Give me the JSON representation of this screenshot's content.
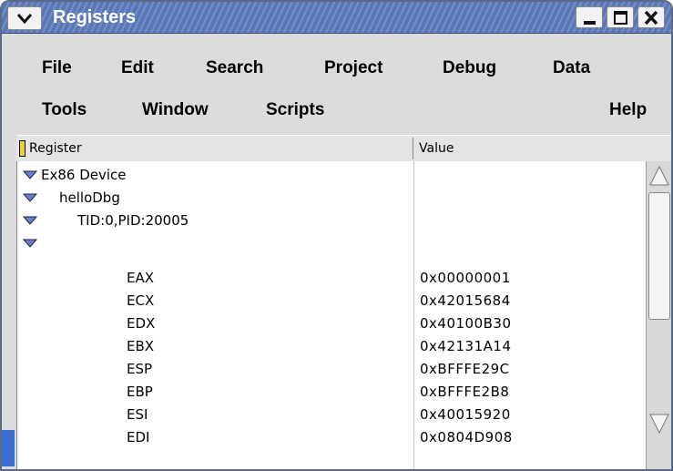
{
  "window": {
    "title": "Registers",
    "titlebar_color": "#6b86c2"
  },
  "menubar": {
    "row1": [
      "File",
      "Edit",
      "Search",
      "Project",
      "Debug",
      "Data"
    ],
    "row2": [
      "Tools",
      "Window",
      "Scripts"
    ],
    "help": "Help"
  },
  "columns": {
    "register": "Register",
    "value": "Value"
  },
  "tree": {
    "device": "Ex86 Device",
    "program": "helloDbg",
    "thread": "TID:0,PID:20005"
  },
  "registers": [
    {
      "name": "EAX",
      "value": "0x00000001"
    },
    {
      "name": "ECX",
      "value": "0x42015684"
    },
    {
      "name": "EDX",
      "value": "0x40100B30"
    },
    {
      "name": "EBX",
      "value": "0x42131A14"
    },
    {
      "name": "ESP",
      "value": "0xBFFFE29C"
    },
    {
      "name": "EBP",
      "value": "0xBFFFE2B8"
    },
    {
      "name": "ESI",
      "value": "0x40015920"
    },
    {
      "name": "EDI",
      "value": "0x0804D908"
    }
  ],
  "icons": {
    "expand": "triangle-down-icon",
    "window_menu": "chevron-down-icon",
    "minimize": "minimize-icon",
    "maximize": "maximize-icon",
    "close": "close-icon"
  }
}
